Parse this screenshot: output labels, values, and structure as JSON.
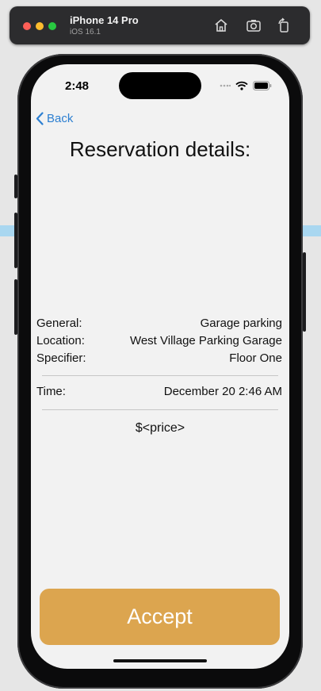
{
  "simulator": {
    "device_name": "iPhone 14 Pro",
    "os": "iOS 16.1"
  },
  "status_bar": {
    "time": "2:48"
  },
  "nav": {
    "back_label": "Back"
  },
  "reservation": {
    "title": "Reservation details:",
    "general_label": "General:",
    "general_value": "Garage parking",
    "location_label": "Location:",
    "location_value": "West Village Parking Garage",
    "specifier_label": "Specifier:",
    "specifier_value": "Floor One",
    "time_label": "Time:",
    "time_value": "December 20 2:46 AM",
    "price": "$<price>",
    "accept_label": "Accept"
  },
  "colors": {
    "accent_button": "#dca54f",
    "link_blue": "#2c7fd1",
    "screen_bg": "#f2f2f2"
  }
}
